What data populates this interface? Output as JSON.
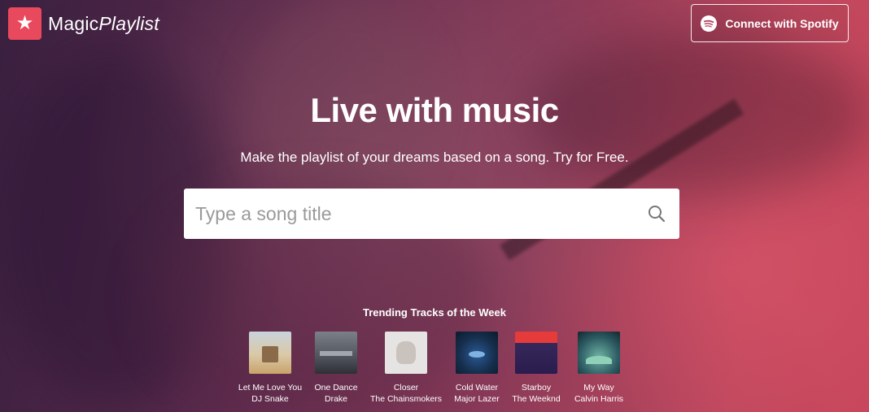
{
  "header": {
    "logo_icon": "star-icon",
    "logo_brand_first": "Magic",
    "logo_brand_second": "Playlist",
    "connect_button": {
      "icon": "spotify-icon",
      "label": "Connect with Spotify"
    }
  },
  "hero": {
    "title": "Live with music",
    "subtitle": "Make the playlist of your dreams based on a song. Try for Free."
  },
  "search": {
    "placeholder": "Type a song title",
    "value": "",
    "icon": "search-icon"
  },
  "trending": {
    "heading": "Trending Tracks of the Week",
    "tracks": [
      {
        "title": "Let Me Love You",
        "artist": "DJ Snake"
      },
      {
        "title": "One Dance",
        "artist": "Drake"
      },
      {
        "title": "Closer",
        "artist": "The Chainsmokers"
      },
      {
        "title": "Cold Water",
        "artist": "Major Lazer"
      },
      {
        "title": "Starboy",
        "artist": "The Weeknd"
      },
      {
        "title": "My Way",
        "artist": "Calvin Harris"
      }
    ]
  },
  "colors": {
    "brand_accent": "#e8495c",
    "hero_gradient_start": "#3a2040",
    "hero_gradient_end": "#c9475c"
  }
}
